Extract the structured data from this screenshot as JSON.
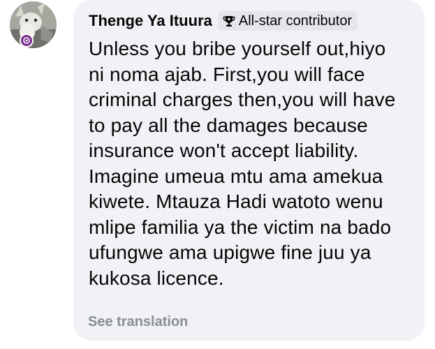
{
  "comment": {
    "author_name": "Thenge Ya Ituura",
    "author_badge": {
      "label": "All-star contributor",
      "icon": "trophy-icon"
    },
    "avatar": {
      "icon": "goat-avatar-image",
      "status_icon": "community-badge-icon",
      "status_color": "#7b2a8c"
    },
    "text_lines": [
      "Unless you bribe yourself out,hiyo",
      "ni noma ajab. First,you will face",
      "criminal charges then,you will have",
      "to pay all the damages because",
      "insurance won't accept liability.",
      "Imagine umeua mtu ama amekua",
      "kiwete. Mtauza Hadi watoto wenu",
      "mlipe familia ya the victim na bado",
      "ufungwe ama upigwe fine juu ya",
      "kukosa licence."
    ],
    "see_translation_label": "See translation"
  },
  "colors": {
    "bubble_background": "#f0f2f5",
    "badge_background": "#e4e6eb",
    "text_primary": "#050505",
    "text_secondary": "#8a8d91"
  }
}
